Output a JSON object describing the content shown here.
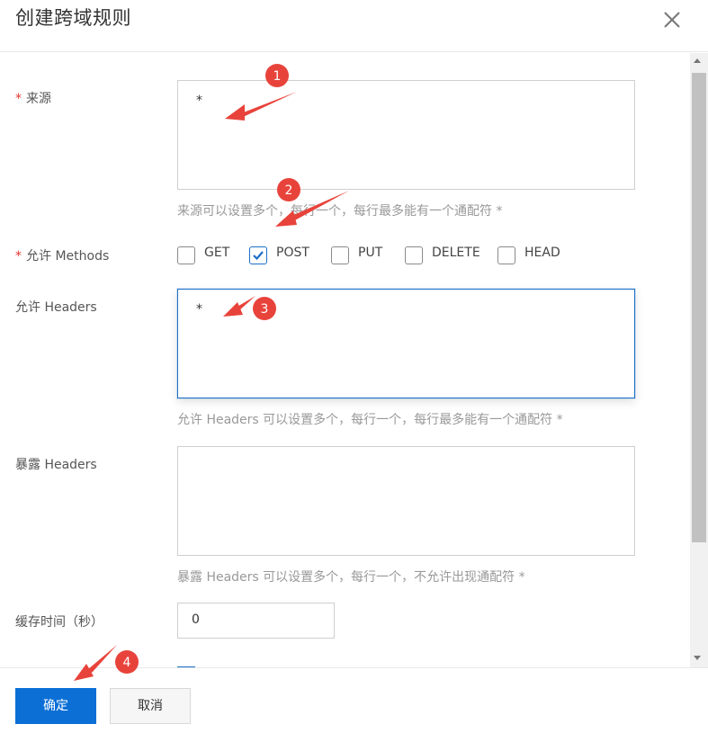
{
  "dialog": {
    "title": "创建跨域规则"
  },
  "form": {
    "origin": {
      "label": "来源",
      "required_mark": "*",
      "value": "*",
      "hint": "来源可以设置多个，每行一个，每行最多能有一个通配符 *"
    },
    "methods": {
      "label": "允许 Methods",
      "required_mark": "*",
      "options": [
        {
          "label": "GET",
          "checked": false
        },
        {
          "label": "POST",
          "checked": true
        },
        {
          "label": "PUT",
          "checked": false
        },
        {
          "label": "DELETE",
          "checked": false
        },
        {
          "label": "HEAD",
          "checked": false
        }
      ]
    },
    "allow_headers": {
      "label": "允许 Headers",
      "value": "*",
      "hint": "允许 Headers 可以设置多个，每行一个，每行最多能有一个通配符 *"
    },
    "expose_headers": {
      "label": "暴露 Headers",
      "value": "",
      "hint": "暴露 Headers 可以设置多个，每行一个，不允许出现通配符 *"
    },
    "cache_time": {
      "label": "缓存时间（秒）",
      "value": "0"
    }
  },
  "footer": {
    "confirm_label": "确定",
    "cancel_label": "取消"
  },
  "annotations": {
    "color": "#e8433b",
    "badges": [
      "1",
      "2",
      "3",
      "4"
    ]
  },
  "colors": {
    "primary": "#0b6fd6",
    "required": "#e5332b",
    "focus_border": "#1d6fc8"
  }
}
